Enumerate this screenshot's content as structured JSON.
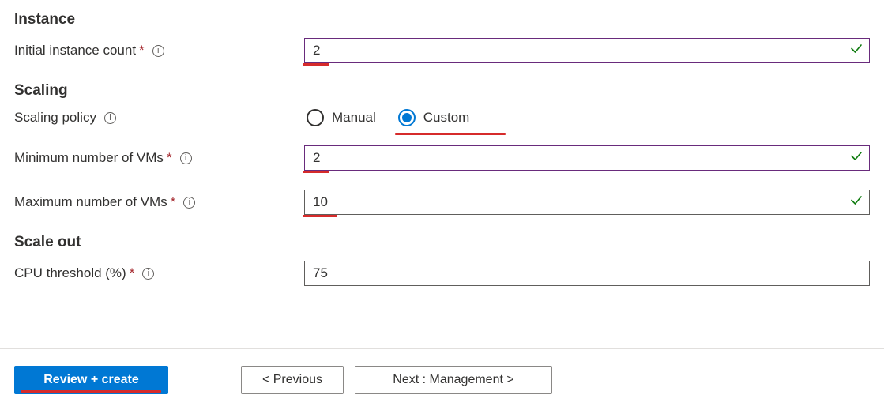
{
  "sections": {
    "instance": {
      "header": "Instance"
    },
    "scaling": {
      "header": "Scaling"
    },
    "scaleOut": {
      "header": "Scale out"
    }
  },
  "fields": {
    "initialInstanceCount": {
      "label": "Initial instance count",
      "value": "2",
      "required": true,
      "valid": true
    },
    "scalingPolicy": {
      "label": "Scaling policy",
      "options": {
        "manual": "Manual",
        "custom": "Custom"
      },
      "selected": "custom"
    },
    "minVMs": {
      "label": "Minimum number of VMs",
      "value": "2",
      "required": true,
      "valid": true
    },
    "maxVMs": {
      "label": "Maximum number of VMs",
      "value": "10",
      "required": true,
      "valid": true
    },
    "cpuThreshold": {
      "label": "CPU threshold (%)",
      "value": "75",
      "required": true
    }
  },
  "footer": {
    "review": "Review + create",
    "previous": "< Previous",
    "next": "Next : Management >"
  }
}
